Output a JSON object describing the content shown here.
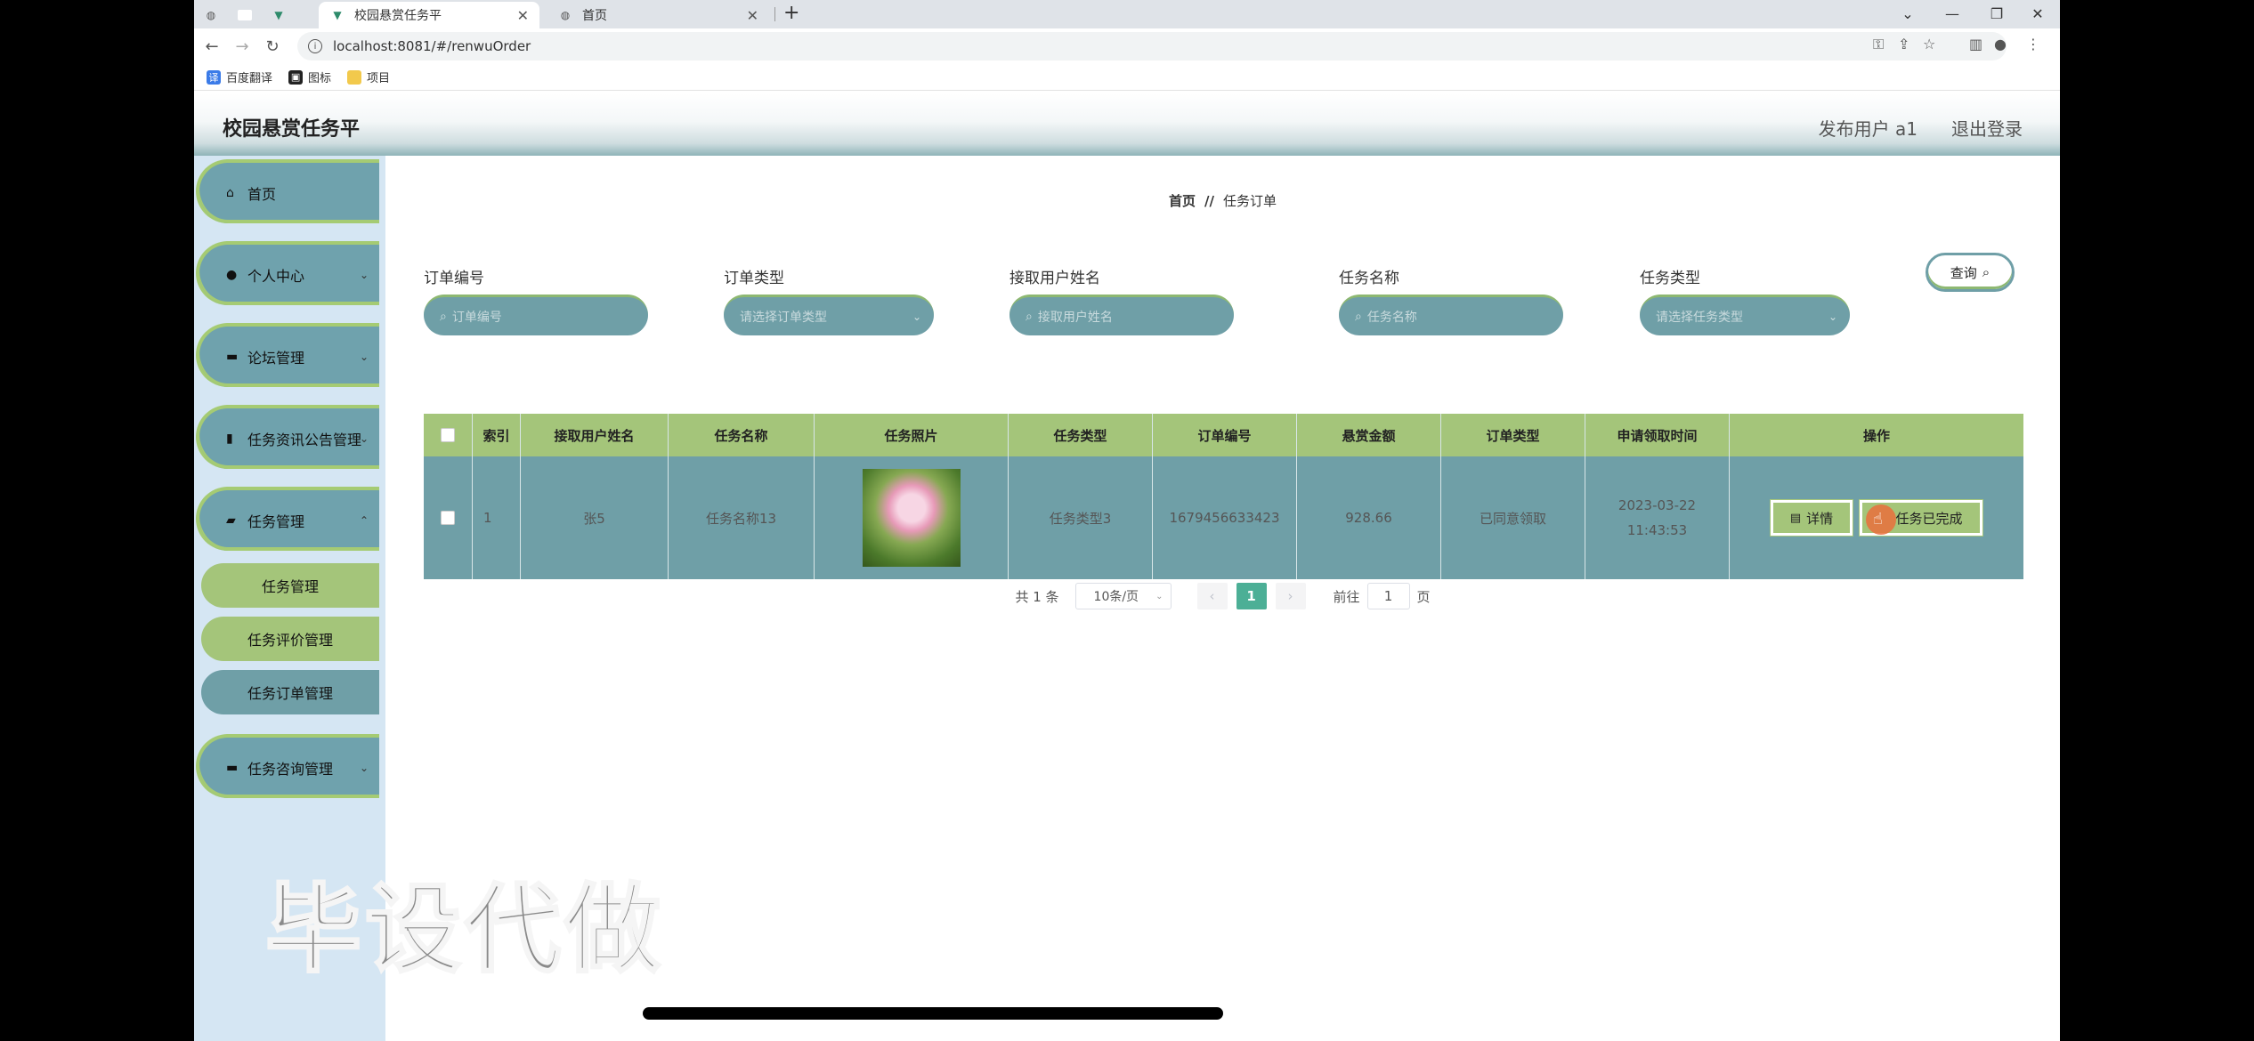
{
  "browser": {
    "tabs": [
      {
        "title": "校园悬赏任务平",
        "active": true
      },
      {
        "title": "首页",
        "active": false
      }
    ],
    "url": "localhost:8081/#/renwuOrder",
    "bookmarks": [
      "百度翻译",
      "图标",
      "项目"
    ]
  },
  "app": {
    "title": "校园悬赏任务平",
    "user": "发布用户 a1",
    "logout": "退出登录"
  },
  "sidebar": {
    "menus": [
      {
        "label": "首页",
        "icon": "home-icon"
      },
      {
        "label": "个人中心",
        "icon": "user-icon"
      },
      {
        "label": "论坛管理",
        "icon": "monitor-icon"
      },
      {
        "label": "任务资讯公告管理",
        "icon": "chart-icon"
      },
      {
        "label": "任务管理",
        "icon": "briefcase-icon"
      },
      {
        "label": "任务咨询管理",
        "icon": "chat-icon"
      }
    ],
    "submenus": [
      "任务管理",
      "任务评价管理",
      "任务订单管理"
    ]
  },
  "breadcrumb": {
    "home": "首页",
    "separator": "//",
    "current": "任务订单"
  },
  "search": {
    "fields": [
      {
        "label": "订单编号",
        "placeholder": "订单编号"
      },
      {
        "label": "订单类型",
        "placeholder": "请选择订单类型"
      },
      {
        "label": "接取用户姓名",
        "placeholder": "接取用户姓名"
      },
      {
        "label": "任务名称",
        "placeholder": "任务名称"
      },
      {
        "label": "任务类型",
        "placeholder": "请选择任务类型"
      }
    ],
    "query_label": "查询"
  },
  "table": {
    "headers": [
      "索引",
      "接取用户姓名",
      "任务名称",
      "任务照片",
      "任务类型",
      "订单编号",
      "悬赏金额",
      "订单类型",
      "申请领取时间",
      "操作"
    ],
    "rows": [
      {
        "index": "1",
        "user": "张5",
        "task_name": "任务名称13",
        "task_type": "任务类型3",
        "order_no": "1679456633423",
        "amount": "928.66",
        "order_type": "已同意领取",
        "time": "2023-03-22 11:43:53",
        "actions": {
          "detail": "详情",
          "finish": "任务已完成"
        }
      }
    ]
  },
  "pagination": {
    "total": "共 1 条",
    "page_size": "10条/页",
    "current": "1",
    "goto_prefix": "前往",
    "goto_value": "1",
    "goto_suffix": "页"
  },
  "overlay": {
    "watermark": "毕设代做"
  },
  "colors": {
    "teal": "#6f9fa7",
    "green": "#a4c57a",
    "page_active": "#4caf96"
  }
}
